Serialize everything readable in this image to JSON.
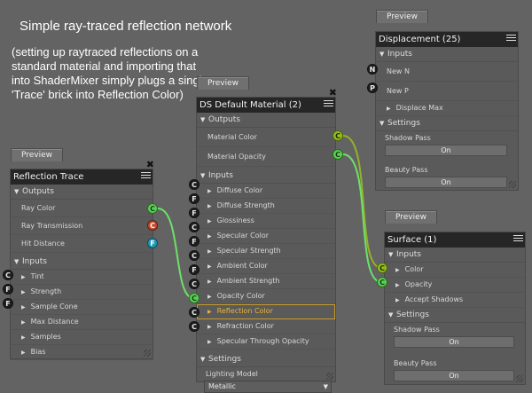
{
  "title": "Simple ray-traced reflection network",
  "description": "(setting up raytraced reflections on a standard material and importing that into ShaderMixer simply plugs a single 'Trace' brick into Reflection Color)",
  "reflection_trace": {
    "preview": "Preview",
    "title": "Reflection Trace",
    "outputs_label": "Outputs",
    "outputs": [
      {
        "label": "Ray Color",
        "port": "C"
      },
      {
        "label": "Ray Transmission",
        "port": "C"
      },
      {
        "label": "Hit Distance",
        "port": "F"
      }
    ],
    "inputs_label": "Inputs",
    "inputs": [
      {
        "label": "Tint",
        "port": "C"
      },
      {
        "label": "Strength",
        "port": "F"
      },
      {
        "label": "Sample Cone",
        "port": "F"
      },
      {
        "label": "Max Distance"
      },
      {
        "label": "Samples"
      },
      {
        "label": "Bias"
      }
    ]
  },
  "ds_material": {
    "preview": "Preview",
    "title": "DS Default Material (2)",
    "outputs_label": "Outputs",
    "outputs": [
      {
        "label": "Material Color",
        "port": "C"
      },
      {
        "label": "Material Opacity",
        "port": "C"
      }
    ],
    "inputs_label": "Inputs",
    "inputs": [
      {
        "label": "Diffuse Color",
        "port": "C"
      },
      {
        "label": "Diffuse Strength",
        "port": "F"
      },
      {
        "label": "Glossiness",
        "port": "F"
      },
      {
        "label": "Specular Color",
        "port": "C"
      },
      {
        "label": "Specular Strength",
        "port": "F"
      },
      {
        "label": "Ambient Color",
        "port": "C"
      },
      {
        "label": "Ambient Strength",
        "port": "F"
      },
      {
        "label": "Opacity Color",
        "port": "C"
      },
      {
        "label": "Reflection Color",
        "port": "C"
      },
      {
        "label": "Refraction Color",
        "port": "C"
      },
      {
        "label": "Specular Through Opacity",
        "port": "C"
      }
    ],
    "settings_label": "Settings",
    "lighting_model_label": "Lighting Model",
    "lighting_model_value": "Metallic"
  },
  "displacement": {
    "preview": "Preview",
    "title": "Displacement (25)",
    "inputs_label": "Inputs",
    "inputs": [
      {
        "label": "New N",
        "port": "N"
      },
      {
        "label": "New P",
        "port": "P"
      },
      {
        "label": "Displace Max"
      }
    ],
    "settings_label": "Settings",
    "shadow_pass_label": "Shadow Pass",
    "shadow_pass_value": "On",
    "beauty_pass_label": "Beauty Pass",
    "beauty_pass_value": "On"
  },
  "surface": {
    "preview": "Preview",
    "title": "Surface (1)",
    "inputs_label": "Inputs",
    "inputs": [
      {
        "label": "Color",
        "port": "C"
      },
      {
        "label": "Opacity",
        "port": "C"
      },
      {
        "label": "Accept Shadows"
      }
    ],
    "settings_label": "Settings",
    "shadow_pass_label": "Shadow Pass",
    "shadow_pass_value": "On",
    "beauty_pass_label": "Beauty Pass",
    "beauty_pass_value": "On"
  },
  "colors": {
    "background": "#636363",
    "brick": "#5a5a5a",
    "title_bar": "#262626",
    "port_color_out": "#59d15a",
    "port_color_out_alt": "#93bf1e",
    "port_transmission": "#c24b2c",
    "port_float_out": "#1f9ab5",
    "link_bright": "#6ee06a",
    "link_olive": "#95b227",
    "highlight": "#e8b43a"
  }
}
